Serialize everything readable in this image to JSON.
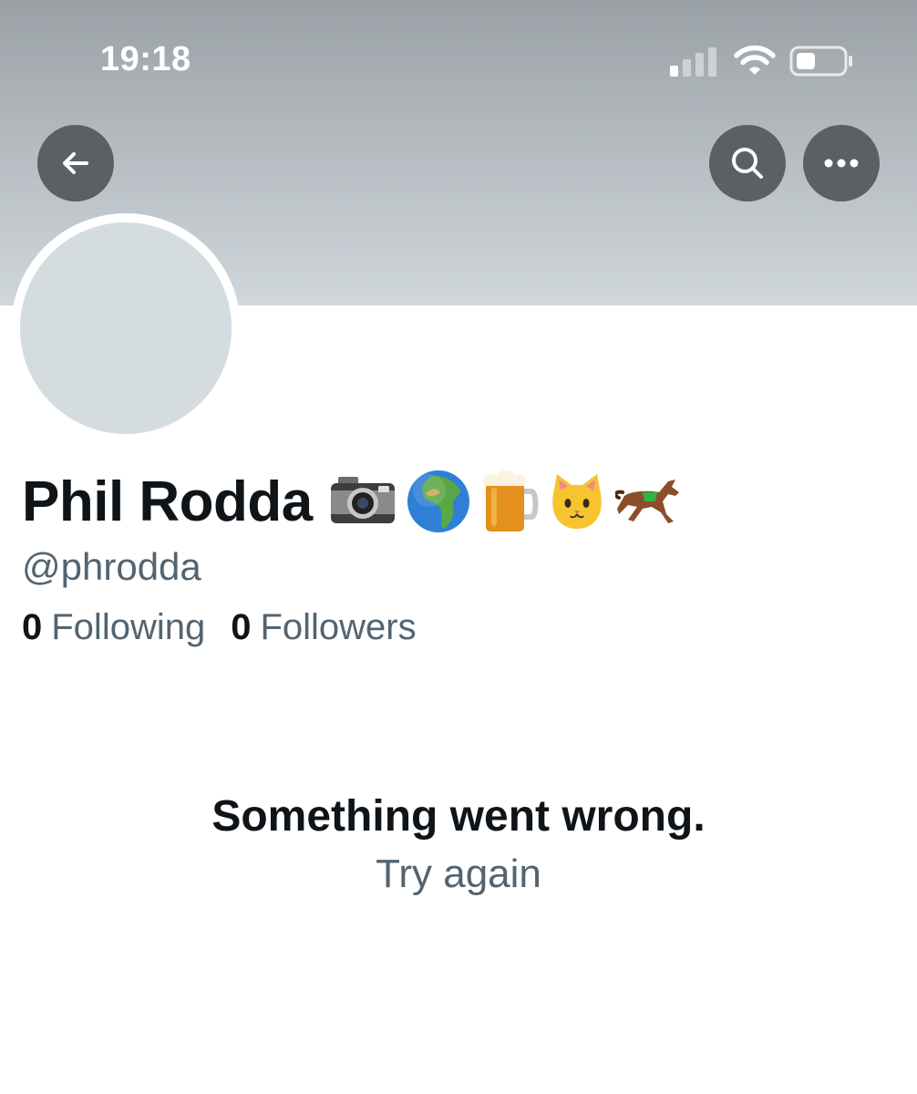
{
  "status_bar": {
    "time": "19:18",
    "icons": [
      "cellular-signal-icon",
      "wifi-icon",
      "battery-icon"
    ]
  },
  "header": {
    "back_icon": "arrow-left-icon",
    "search_icon": "search-icon",
    "more_icon": "more-horizontal-icon"
  },
  "profile": {
    "name": "Phil Rodda",
    "name_emoji": [
      "camera-emoji",
      "globe-africa-emoji",
      "beer-mug-emoji",
      "cat-face-emoji",
      "horse-racing-emoji"
    ],
    "handle": "@phrodda",
    "following_count": "0",
    "following_label": "Following",
    "followers_count": "0",
    "followers_label": "Followers"
  },
  "error": {
    "message": "Something went wrong.",
    "retry_label": "Try again"
  },
  "colors": {
    "banner_top": "#9aa1a6",
    "banner_bottom": "#d0d7dc",
    "avatar_placeholder": "#d4dce0",
    "header_button_bg": "#5b6065",
    "primary_text": "#0f1419",
    "secondary_text": "#536471"
  }
}
